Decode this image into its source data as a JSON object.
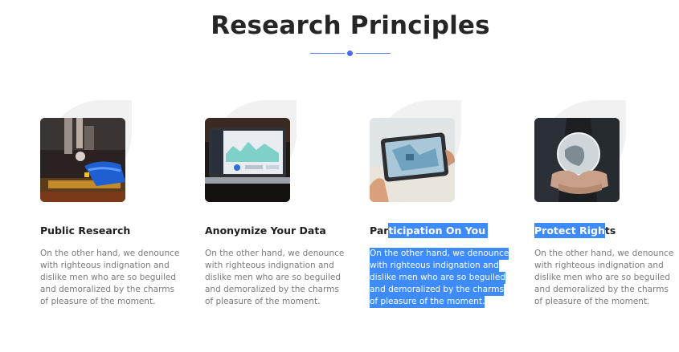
{
  "section": {
    "title": "Research Principles"
  },
  "cards": [
    {
      "title": "Public Research",
      "text": [
        "On the other hand, we denounce",
        "with righteous indignation and",
        "dislike men who are so beguiled",
        "and demoralized by the charms",
        "of pleasure of the moment."
      ]
    },
    {
      "title": "Anonymize Your Data",
      "text": [
        "On the other hand, we denounce",
        "with righteous indignation and",
        "dislike men who are so beguiled",
        "and demoralized by the charms",
        "of pleasure of the moment."
      ]
    },
    {
      "title_plain": "Par",
      "title_selected": "ticipation On You",
      "text": [
        "On the other hand, we denounce",
        "with righteous indignation and",
        "dislike men who are so beguiled",
        "and demoralized by the charms",
        "of pleasure of the moment."
      ]
    },
    {
      "title_selected": "Protect Righ",
      "title_plain": "ts",
      "text": [
        "On the other hand, we denounce",
        "with righteous indignation and",
        "dislike men who are so beguiled",
        "and demoralized by the charms",
        "of pleasure of the moment."
      ]
    }
  ],
  "colors": {
    "accent": "#4a6cf0",
    "selection": "#3d8bfd",
    "blob": "#f1f1f1"
  }
}
